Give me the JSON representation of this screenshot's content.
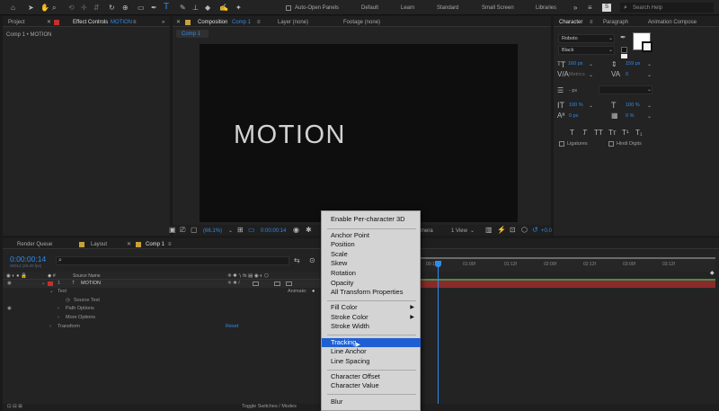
{
  "toolbar": {
    "auto_open_panels": "Auto-Open Panels",
    "workspaces": [
      "Default",
      "Learn",
      "Standard",
      "Small Screen",
      "Libraries"
    ],
    "search_help": "Search Help"
  },
  "left_panel": {
    "project_tab": "Project",
    "effect_controls_label": "Effect Controls",
    "effect_controls_layer": "MOTION",
    "breadcrumb": "Comp 1 • MOTION"
  },
  "viewer": {
    "composition_label": "Composition",
    "composition_name": "Comp 1",
    "layer_tab": "Layer (none)",
    "footage_tab": "Footage (none)",
    "comp_pill": "Comp 1",
    "canvas_text": "MOTION",
    "zoom": "(66.1%)",
    "timecode": "0:00:00:14",
    "camera": "mera",
    "view": "1 View",
    "exposure": "+0.0"
  },
  "character": {
    "tabs": [
      "Character",
      "Paragraph",
      "Animation Compose"
    ],
    "font": "Roboto",
    "style": "Black",
    "font_size": "160 px",
    "leading": "159 px",
    "kerning": "Metrics",
    "tracking": "0",
    "stroke_width": "- px",
    "vert_scale": "100 %",
    "horiz_scale": "100 %",
    "baseline_shift": "0 px",
    "tsume": "0 %",
    "ligatures": "Ligatures",
    "hindi_digits": "Hindi Digits"
  },
  "timeline": {
    "tabs": [
      "Render Queue",
      "Layout",
      "Comp 1"
    ],
    "timecode": "0:00:00:14",
    "fps": "00014 (25.00 fps)",
    "search_placeholder": "",
    "columns": {
      "source_name": "Source Name"
    },
    "layer_number": "1",
    "layer_name": "MOTION",
    "animate": "Animate:",
    "rows": [
      "Text",
      "Source Text",
      "Path Options",
      "More Options",
      "Transform"
    ],
    "reset": "Reset",
    "ruler": [
      "00:12f",
      "01:00f",
      "01:12f",
      "02:00f",
      "02:12f",
      "03:00f",
      "03:12f"
    ],
    "toggle": "Toggle Switches / Modes"
  },
  "context_menu": {
    "groups": [
      [
        "Enable Per-character 3D"
      ],
      [
        "Anchor Point",
        "Position",
        "Scale",
        "Skew",
        "Rotation",
        "Opacity",
        "All Transform Properties"
      ],
      [
        "Fill Color",
        "Stroke Color",
        "Stroke Width"
      ],
      [
        "Tracking",
        "Line Anchor",
        "Line Spacing"
      ],
      [
        "Character Offset",
        "Character Value"
      ],
      [
        "Blur"
      ]
    ],
    "highlighted": "Tracking"
  },
  "colors": {
    "accent": "#2d8ceb",
    "label_red": "#c3302e",
    "menu_highlight": "#1e60d3",
    "green_bar": "#4a8a4a"
  }
}
